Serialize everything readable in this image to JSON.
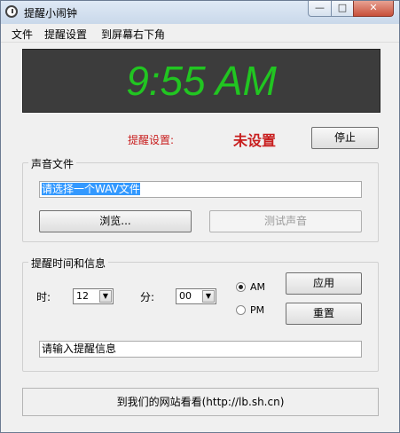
{
  "window": {
    "title": "提醒小闹钟",
    "min_glyph": "—",
    "max_glyph": "□",
    "close_glyph": "✕"
  },
  "menu": {
    "file": "文件",
    "reminder_settings": "提醒设置",
    "move_to_corner": "到屏幕右下角"
  },
  "clock": {
    "time": "9:55 AM"
  },
  "status": {
    "label": "提醒设置:",
    "value": "未设置",
    "stop_button": "停止"
  },
  "sound": {
    "group_title": "声音文件",
    "file_input_value": "请选择一个WAV文件",
    "browse_button": "浏览...",
    "test_button": "测试声音"
  },
  "reminder": {
    "group_title": "提醒时间和信息",
    "hour_label": "时:",
    "hour_value": "12",
    "minute_label": "分:",
    "minute_value": "00",
    "am_label": "AM",
    "pm_label": "PM",
    "apply_button": "应用",
    "reset_button": "重置",
    "message_value": "请输入提醒信息"
  },
  "footer": {
    "text": "到我们的网站看看(http://lb.sh.cn)"
  },
  "colors": {
    "clock_digits": "#21c521",
    "clock_bg": "#3c3c3c",
    "status_red": "#c81e1e"
  }
}
